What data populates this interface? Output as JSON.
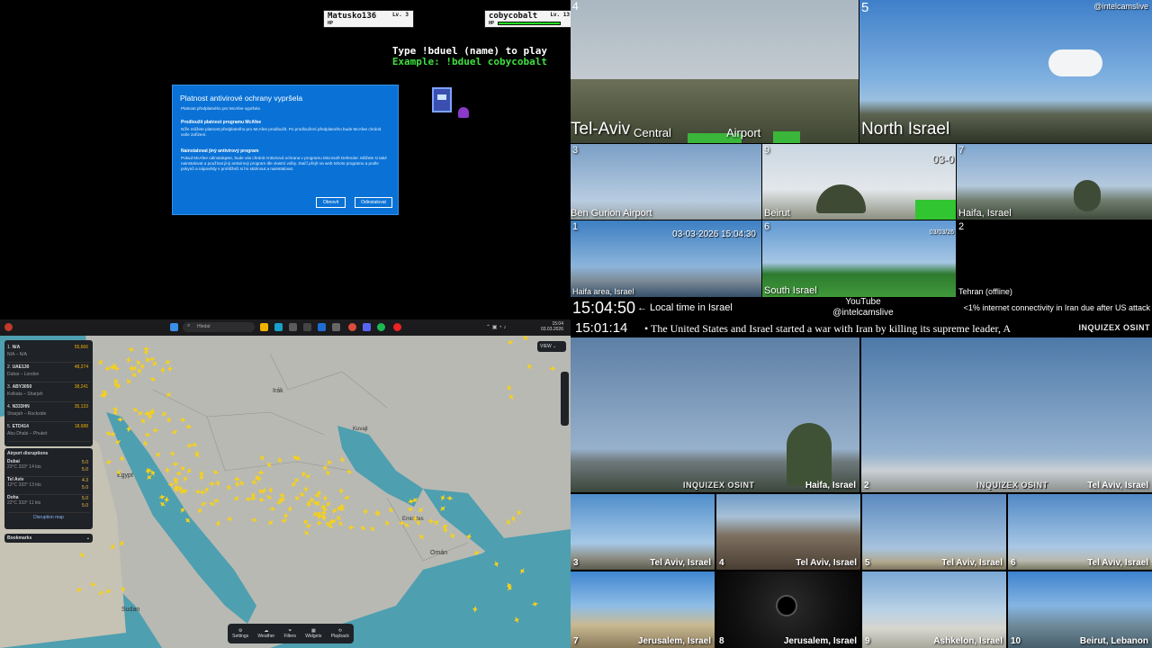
{
  "game": {
    "player1": {
      "name": "Matusko136",
      "level": "Lv. 3",
      "hp": "HP"
    },
    "player2": {
      "name": "cobycobalt",
      "level": "Lv. 13",
      "hp": "HP"
    },
    "prompt_line1": "Type !bduel (name) to play",
    "prompt_line2": "Example: !bduel cobycobalt"
  },
  "dialog": {
    "title": "Platnost antivirové ochrany vypršela",
    "line1": "Platnost předplatného pro McAfee vypršela",
    "heading1": "Prodloužit platnost programu McAfee",
    "body1": "Níže můžete platnost předplatného pro McAfee prodloužit. Po prodloužení předplatného bude McAfee chránit vaše zařízení.",
    "heading2": "Nainstalovat jiný antivirový program",
    "body2": "Pokud McAfee odinstalujete, bude vás chránit Antivirová ochrana v programu Microsoft Defender. Můžete si také nainstalovat a používat jiný antivirový program dle vlastní volby. Stačí přejít na web tohoto programu a podle pokynů a nápovědy v prohlížeči si ho stáhnout a nainstalovat.",
    "btn_renew": "Obnovit",
    "btn_uninstall": "Odinstalovat"
  },
  "taskbar": {
    "search_placeholder": "Hledat",
    "time": "15:04",
    "date": "03.03.2026"
  },
  "flights": {
    "list": [
      {
        "rank": "1.",
        "callsign": "N/A",
        "value": "55,666",
        "route": "N/A – N/A"
      },
      {
        "rank": "2.",
        "callsign": "UAE130",
        "value": "48,274",
        "route": "Dubai – London"
      },
      {
        "rank": "3.",
        "callsign": "ABY3050",
        "value": "38,241",
        "route": "Kolkata – Sharjah"
      },
      {
        "rank": "4.",
        "callsign": "N333HN",
        "value": "35,133",
        "route": "Sharjah – Rockside"
      },
      {
        "rank": "5.",
        "callsign": "ETD414",
        "value": "18,688",
        "route": "Abu Dhabi – Phuket"
      }
    ],
    "disruptions_title": "Airport disruptions",
    "airports": [
      {
        "name": "Dubai",
        "temp": "23°C",
        "wind": "333° 14 kts",
        "a": "5.0",
        "b": "5.0"
      },
      {
        "name": "Tel Aviv",
        "temp": "12°C",
        "wind": "333° 13 kts",
        "a": "4.3",
        "b": "5.0"
      },
      {
        "name": "Doha",
        "temp": "22°C",
        "wind": "333° 11 kts",
        "a": "5.0",
        "b": "5.0"
      }
    ],
    "disruption_link": "Disruption map",
    "bookmarks": "Bookmarks",
    "map_labels": {
      "iraq": "Irák",
      "egypt": "Egypt",
      "sudan": "Sudan",
      "oman": "Omán",
      "emirates": "Emirates",
      "kuwait": "Kuvajt"
    },
    "bottom_tools": [
      "Settings",
      "Weather",
      "Filters",
      "Widgets",
      "Playback"
    ]
  },
  "cams_top": {
    "channel": "@intelcamslive",
    "c4_label": "Tel-Aviv",
    "c4_central": "Central",
    "c4_airport": "Airport",
    "c4_num": "4",
    "c5_label": "North Israel",
    "c5_num": "5",
    "c3_label": "Ben Gurion Airport",
    "c3_num": "3",
    "c9_label": "Beirut",
    "c9_num": "9",
    "c9_ts": "03-0",
    "c7_label": "Haifa, Israel",
    "c7_num": "7",
    "c1_label": "Haifa area, Israel",
    "c1_num": "1",
    "c1_ts": "03-03-2026 15:04:30",
    "c6_label": "South Israel",
    "c6_num": "6",
    "c6_ts": "03/03/26",
    "c2_label": "Tehran (offline)",
    "c2_num": "2"
  },
  "ticker": {
    "local_time": "15:04:50",
    "local_label": "← Local time in Israel",
    "yt_line1": "YouTube",
    "yt_line2": "@intelcamslive",
    "iran_note": "<1% internet connectivity in Iran due after US attack",
    "second_time": "15:01:14",
    "news": "The United States and Israel started a war with Iran by killing its supreme leader, A",
    "watermark": "INQUIZEX OSINT"
  },
  "cams_bottom": [
    {
      "num": "",
      "label": "Haifa, Israel"
    },
    {
      "num": "2",
      "label": "Tel Aviv, Israel"
    },
    {
      "num": "3",
      "label": "Tel Aviv, Israel"
    },
    {
      "num": "4",
      "label": "Tel Aviv, Israel"
    },
    {
      "num": "5",
      "label": "Tel Aviv, Israel"
    },
    {
      "num": "6",
      "label": "Tel Aviv, Israel"
    },
    {
      "num": "7",
      "label": "Jerusalem, Israel"
    },
    {
      "num": "8",
      "label": "Jerusalem, Israel"
    },
    {
      "num": "9",
      "label": "Ashkelon, Israel"
    },
    {
      "num": "10",
      "label": "Beirut, Lebanon"
    }
  ]
}
